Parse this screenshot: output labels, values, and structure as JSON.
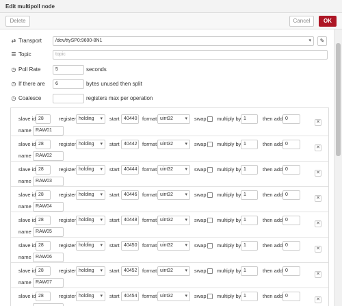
{
  "window": {
    "title": "Edit multipoll node"
  },
  "toolbar": {
    "delete_label": "Delete",
    "cancel_label": "Cancel",
    "ok_label": "OK"
  },
  "form": {
    "transport": {
      "label": "Transport",
      "value": "/dev/ttySP0:9600-8N1",
      "edit_icon": "pencil-icon"
    },
    "topic": {
      "label": "Topic",
      "placeholder": "topic"
    },
    "poll_rate": {
      "label": "Poll Rate",
      "value": "5",
      "unit": "seconds"
    },
    "split": {
      "label": "If there are",
      "value": "6",
      "suffix": "bytes unused then split"
    },
    "coalesce": {
      "label": "Coalesce",
      "value": "",
      "suffix": "registers max per operation"
    }
  },
  "row_labels": {
    "slave_id": "slave id",
    "register": "register",
    "start": "start",
    "format": "format",
    "swap": "swap",
    "multiply": "multiply by",
    "then_add": "then add",
    "name": "name"
  },
  "rows": [
    {
      "slave_id": "28",
      "register": "holding",
      "start": "40440",
      "format": "uint32",
      "multiply": "1",
      "add": "0",
      "name": "RAW01"
    },
    {
      "slave_id": "28",
      "register": "holding",
      "start": "40442",
      "format": "uint32",
      "multiply": "1",
      "add": "0",
      "name": "RAW02"
    },
    {
      "slave_id": "28",
      "register": "holding",
      "start": "40444",
      "format": "uint32",
      "multiply": "1",
      "add": "0",
      "name": "RAW03"
    },
    {
      "slave_id": "28",
      "register": "holding",
      "start": "40446",
      "format": "uint32",
      "multiply": "1",
      "add": "0",
      "name": "RAW04"
    },
    {
      "slave_id": "28",
      "register": "holding",
      "start": "40448",
      "format": "uint32",
      "multiply": "1",
      "add": "0",
      "name": "RAW05"
    },
    {
      "slave_id": "28",
      "register": "holding",
      "start": "40450",
      "format": "uint32",
      "multiply": "1",
      "add": "0",
      "name": "RAW06"
    },
    {
      "slave_id": "28",
      "register": "holding",
      "start": "40452",
      "format": "uint32",
      "multiply": "1",
      "add": "0",
      "name": "RAW07"
    },
    {
      "slave_id": "28",
      "register": "holding",
      "start": "40454",
      "format": "uint32",
      "multiply": "1",
      "add": "0",
      "name": ""
    }
  ],
  "colors": {
    "ok_button": "#ad1625",
    "border": "#cccccc"
  }
}
